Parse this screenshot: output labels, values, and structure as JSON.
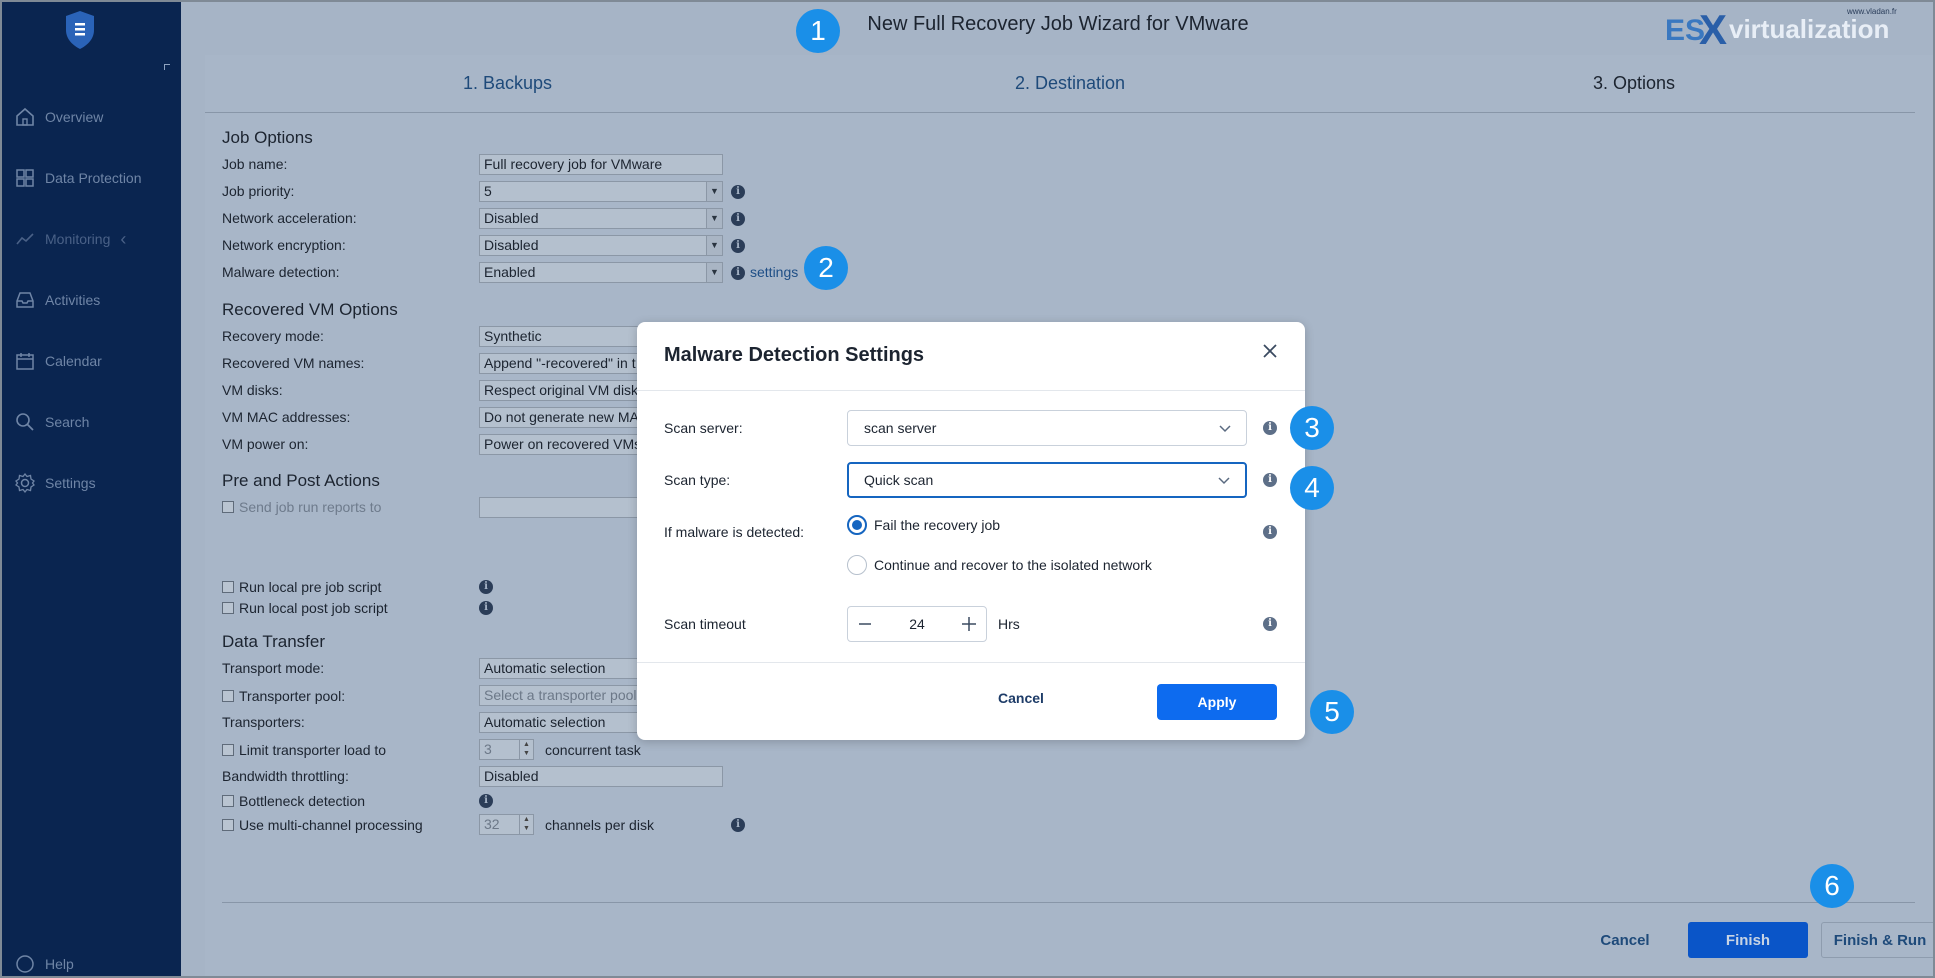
{
  "window": {
    "title": "New Full Recovery Job Wizard for VMware"
  },
  "watermark": {
    "brand_es": "ES",
    "brand_x": "X",
    "brand_rest": "virtualization",
    "site": "www.vladan.fr"
  },
  "sidebar": {
    "items": [
      {
        "label": "Overview",
        "icon": "home-icon"
      },
      {
        "label": "Data Protection",
        "icon": "grid-icon"
      },
      {
        "label": "Monitoring",
        "icon": "chart-icon"
      },
      {
        "label": "Activities",
        "icon": "inbox-icon"
      },
      {
        "label": "Calendar",
        "icon": "calendar-icon"
      },
      {
        "label": "Search",
        "icon": "search-icon"
      },
      {
        "label": "Settings",
        "icon": "gear-icon"
      },
      {
        "label": "Help",
        "icon": "help-icon"
      }
    ]
  },
  "steps": [
    "1. Backups",
    "2. Destination",
    "3. Options"
  ],
  "job_options": {
    "heading": "Job Options",
    "job_name_label": "Job name:",
    "job_name_value": "Full recovery job for VMware",
    "priority_label": "Job priority:",
    "priority_value": "5",
    "net_accel_label": "Network acceleration:",
    "net_accel_value": "Disabled",
    "net_enc_label": "Network encryption:",
    "net_enc_value": "Disabled",
    "malware_label": "Malware detection:",
    "malware_value": "Enabled",
    "settings_link": "settings"
  },
  "recovered_vm": {
    "heading": "Recovered VM Options",
    "mode_label": "Recovery mode:",
    "mode_value": "Synthetic",
    "names_label": "Recovered VM names:",
    "names_value": "Append \"-recovered\" in t",
    "disks_label": "VM disks:",
    "disks_value": "Respect original VM disk",
    "mac_label": "VM MAC addresses:",
    "mac_value": "Do not generate new MA",
    "power_label": "VM power on:",
    "power_value": "Power on recovered VMs"
  },
  "pre_post": {
    "heading": "Pre and Post Actions",
    "send_reports": "Send job run reports to",
    "pre_script": "Run local pre job script",
    "post_script": "Run local post job script"
  },
  "data_transfer": {
    "heading": "Data Transfer",
    "transport_label": "Transport mode:",
    "transport_value": "Automatic selection",
    "pool_label": "Transporter pool:",
    "pool_placeholder": "Select a transporter pool",
    "transporters_label": "Transporters:",
    "transporters_value": "Automatic selection",
    "limit_label": "Limit transporter load to",
    "limit_value": "3",
    "limit_suffix": "concurrent task",
    "bandwidth_label": "Bandwidth throttling:",
    "bandwidth_value": "Disabled",
    "bottleneck_label": "Bottleneck detection",
    "multichannel_label": "Use multi-channel processing",
    "multichannel_value": "32",
    "multichannel_suffix": "channels per disk"
  },
  "footer": {
    "cancel": "Cancel",
    "finish": "Finish",
    "finish_run": "Finish & Run"
  },
  "modal": {
    "title": "Malware Detection Settings",
    "scan_server_label": "Scan server:",
    "scan_server_value": "scan server",
    "scan_type_label": "Scan type:",
    "scan_type_value": "Quick scan",
    "if_detected_label": "If malware is detected:",
    "option_fail": "Fail the recovery job",
    "option_continue": "Continue and recover to the isolated network",
    "timeout_label": "Scan timeout",
    "timeout_value": "24",
    "timeout_unit": "Hrs",
    "cancel": "Cancel",
    "apply": "Apply"
  },
  "badges": [
    "1",
    "2",
    "3",
    "4",
    "5",
    "6"
  ],
  "colors": {
    "accent": "#1565c0",
    "badge": "#1a8fe8",
    "sidebar": "#0a2550"
  }
}
